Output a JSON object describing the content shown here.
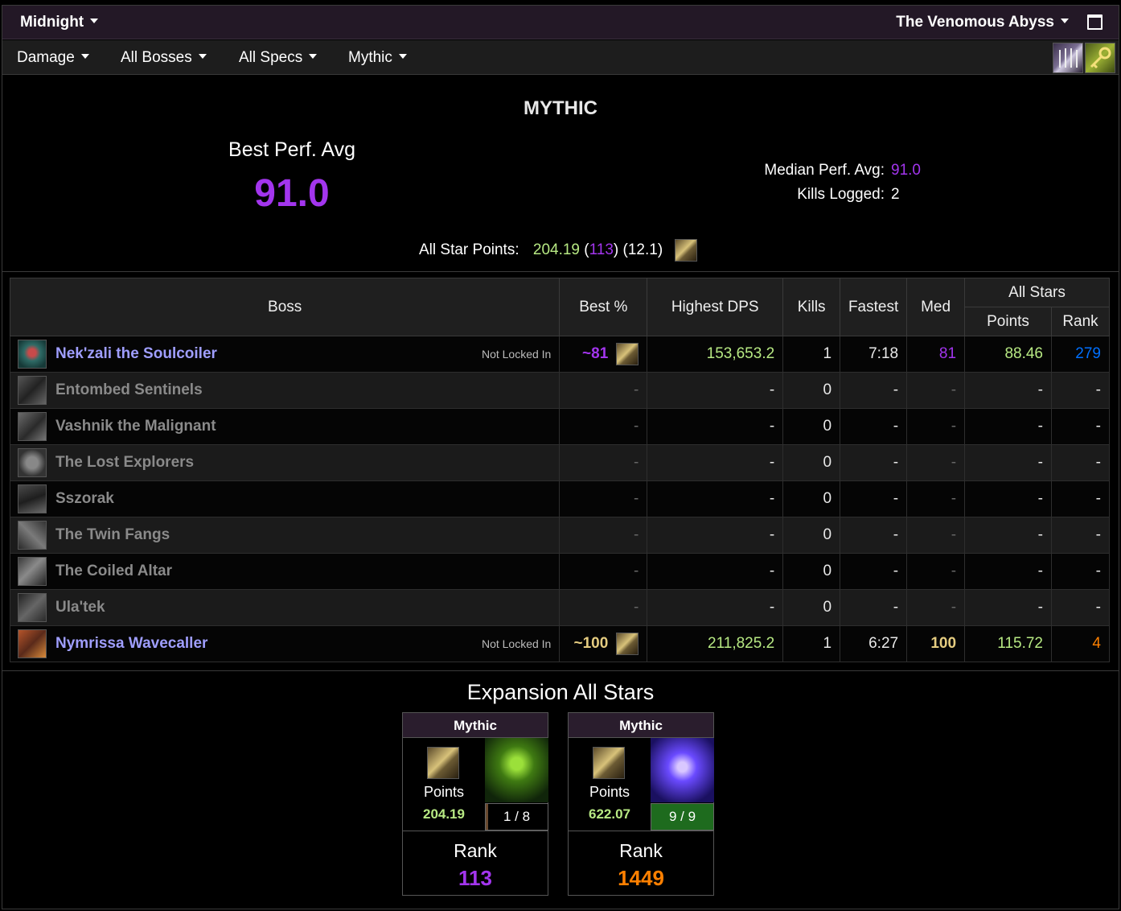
{
  "topbar": {
    "expansion": "Midnight",
    "zone": "The Venomous Abyss"
  },
  "filters": {
    "metric": "Damage",
    "bosses": "All Bosses",
    "specs": "All Specs",
    "difficulty": "Mythic"
  },
  "summary": {
    "title": "MYTHIC",
    "best_perf_label": "Best Perf. Avg",
    "best_perf_value": "91.0",
    "median_label": "Median Perf. Avg:",
    "median_value": "91.0",
    "kills_label": "Kills Logged:",
    "kills_value": "2",
    "star_points_label": "All Star Points:",
    "star_points_value": "204.19",
    "star_rank": "113",
    "star_extra": "(12.1)"
  },
  "table": {
    "headers": {
      "boss": "Boss",
      "best": "Best %",
      "dps": "Highest DPS",
      "kills": "Kills",
      "fastest": "Fastest",
      "med": "Med",
      "all_stars": "All Stars",
      "points": "Points",
      "rank": "Rank"
    },
    "rows": [
      {
        "name": "Nek'zali the Soulcoiler",
        "locked": "Not Locked In",
        "best": "~81",
        "dps": "153,653.2",
        "kills": "1",
        "fastest": "7:18",
        "med": "81",
        "points": "88.46",
        "rank": "279"
      },
      {
        "name": "Entombed Sentinels",
        "best": "-",
        "dps": "-",
        "kills": "0",
        "fastest": "-",
        "med": "-",
        "points": "-",
        "rank": "-"
      },
      {
        "name": "Vashnik the Malignant",
        "best": "-",
        "dps": "-",
        "kills": "0",
        "fastest": "-",
        "med": "-",
        "points": "-",
        "rank": "-"
      },
      {
        "name": "The Lost Explorers",
        "best": "-",
        "dps": "-",
        "kills": "0",
        "fastest": "-",
        "med": "-",
        "points": "-",
        "rank": "-"
      },
      {
        "name": "Sszorak",
        "best": "-",
        "dps": "-",
        "kills": "0",
        "fastest": "-",
        "med": "-",
        "points": "-",
        "rank": "-"
      },
      {
        "name": "The Twin Fangs",
        "best": "-",
        "dps": "-",
        "kills": "0",
        "fastest": "-",
        "med": "-",
        "points": "-",
        "rank": "-"
      },
      {
        "name": "The Coiled Altar",
        "best": "-",
        "dps": "-",
        "kills": "0",
        "fastest": "-",
        "med": "-",
        "points": "-",
        "rank": "-"
      },
      {
        "name": "Ula'tek",
        "best": "-",
        "dps": "-",
        "kills": "0",
        "fastest": "-",
        "med": "-",
        "points": "-",
        "rank": "-"
      },
      {
        "name": "Nymrissa Wavecaller",
        "locked": "Not Locked In",
        "best": "~100",
        "dps": "211,825.2",
        "kills": "1",
        "fastest": "6:27",
        "med": "100",
        "points": "115.72",
        "rank": "4"
      }
    ]
  },
  "expansion": {
    "title": "Expansion All Stars",
    "cards": [
      {
        "head": "Mythic",
        "points_label": "Points",
        "points": "204.19",
        "progress": "1 / 8",
        "rank_label": "Rank",
        "rank": "113"
      },
      {
        "head": "Mythic",
        "points_label": "Points",
        "points": "622.07",
        "progress": "9 / 9",
        "rank_label": "Rank",
        "rank": "1449"
      }
    ]
  },
  "colors": {
    "epic": "#a335ee",
    "legendary": "#ff8000",
    "rare": "#0070ff",
    "points_green": "#b7e983",
    "boss_active": "#9f9eff",
    "mythic_gold": "#e5cc80"
  }
}
